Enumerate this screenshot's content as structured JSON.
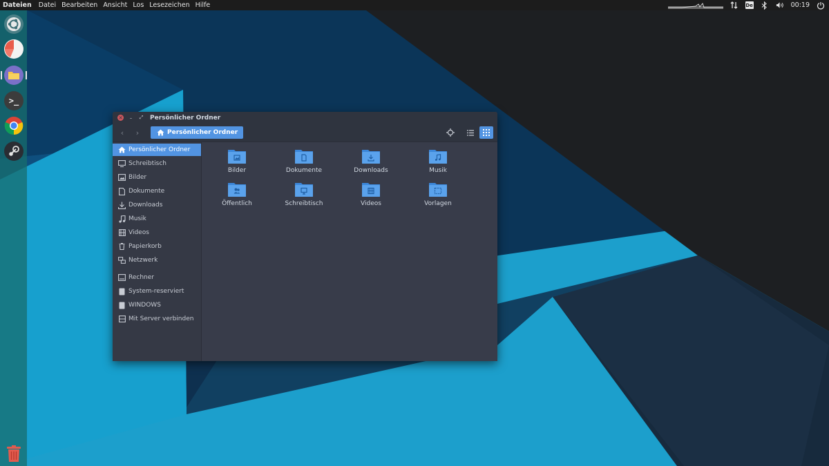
{
  "top_panel": {
    "app_name": "Dateien",
    "menu": [
      "Datei",
      "Bearbeiten",
      "Ansicht",
      "Los",
      "Lesezeichen",
      "Hilfe"
    ],
    "keyboard_layout": "De",
    "clock": "00:19"
  },
  "launcher": {
    "items": [
      "ubuntu-logo-icon",
      "disk-usage-icon",
      "files-icon",
      "terminal-icon",
      "chrome-icon",
      "steam-icon"
    ],
    "trash": "trash-icon"
  },
  "window": {
    "title": "Persönlicher Ordner",
    "path_label": "Persönlicher Ordner",
    "sidebar": [
      "Persönlicher Ordner",
      "Schreibtisch",
      "Bilder",
      "Dokumente",
      "Downloads",
      "Musik",
      "Videos",
      "Papierkorb",
      "Netzwerk",
      "Rechner",
      "System-reserviert",
      "WINDOWS",
      "Mit Server verbinden"
    ],
    "folders": [
      "Bilder",
      "Dokumente",
      "Downloads",
      "Musik",
      "Öffentlich",
      "Schreibtisch",
      "Videos",
      "Vorlagen"
    ]
  },
  "colors": {
    "accent": "#5294e2",
    "window_bg": "#383c4a",
    "titlebar_bg": "#2f343f"
  }
}
